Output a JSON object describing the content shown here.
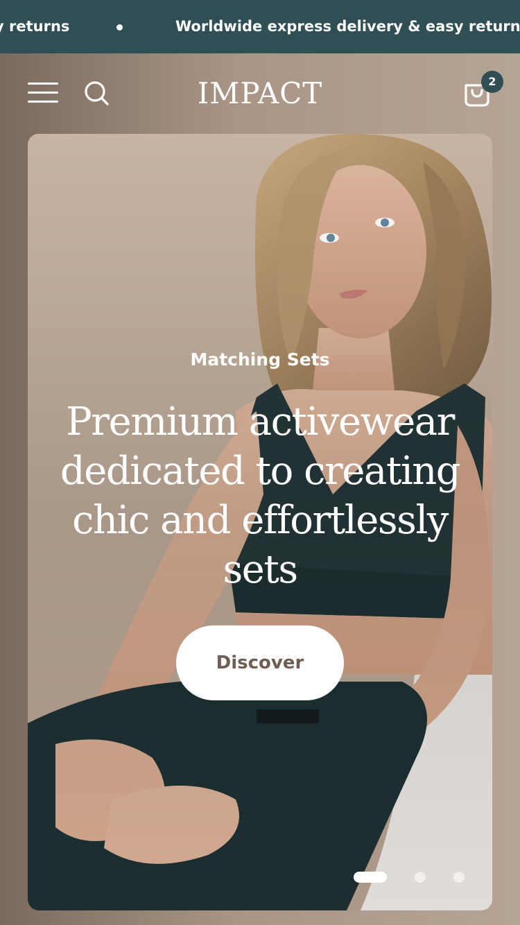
{
  "announcement": {
    "message_previous": "y returns",
    "message_current": "Worldwide express delivery & easy returns"
  },
  "header": {
    "logo": "IMPACT",
    "cart_count": "2",
    "icons": [
      "menu-icon",
      "search-icon",
      "cart-icon"
    ]
  },
  "hero": {
    "eyebrow": "Matching Sets",
    "headline": "Premium activewear dedicated to creating chic and effortlessly sets",
    "button_label": "Discover",
    "slides_total": 3,
    "active_slide": 1
  },
  "colors": {
    "announcement_bg": "#2f4f55",
    "badge_bg": "#2f4f55",
    "button_text": "#6f5e51",
    "page_bg": "#a89585"
  }
}
